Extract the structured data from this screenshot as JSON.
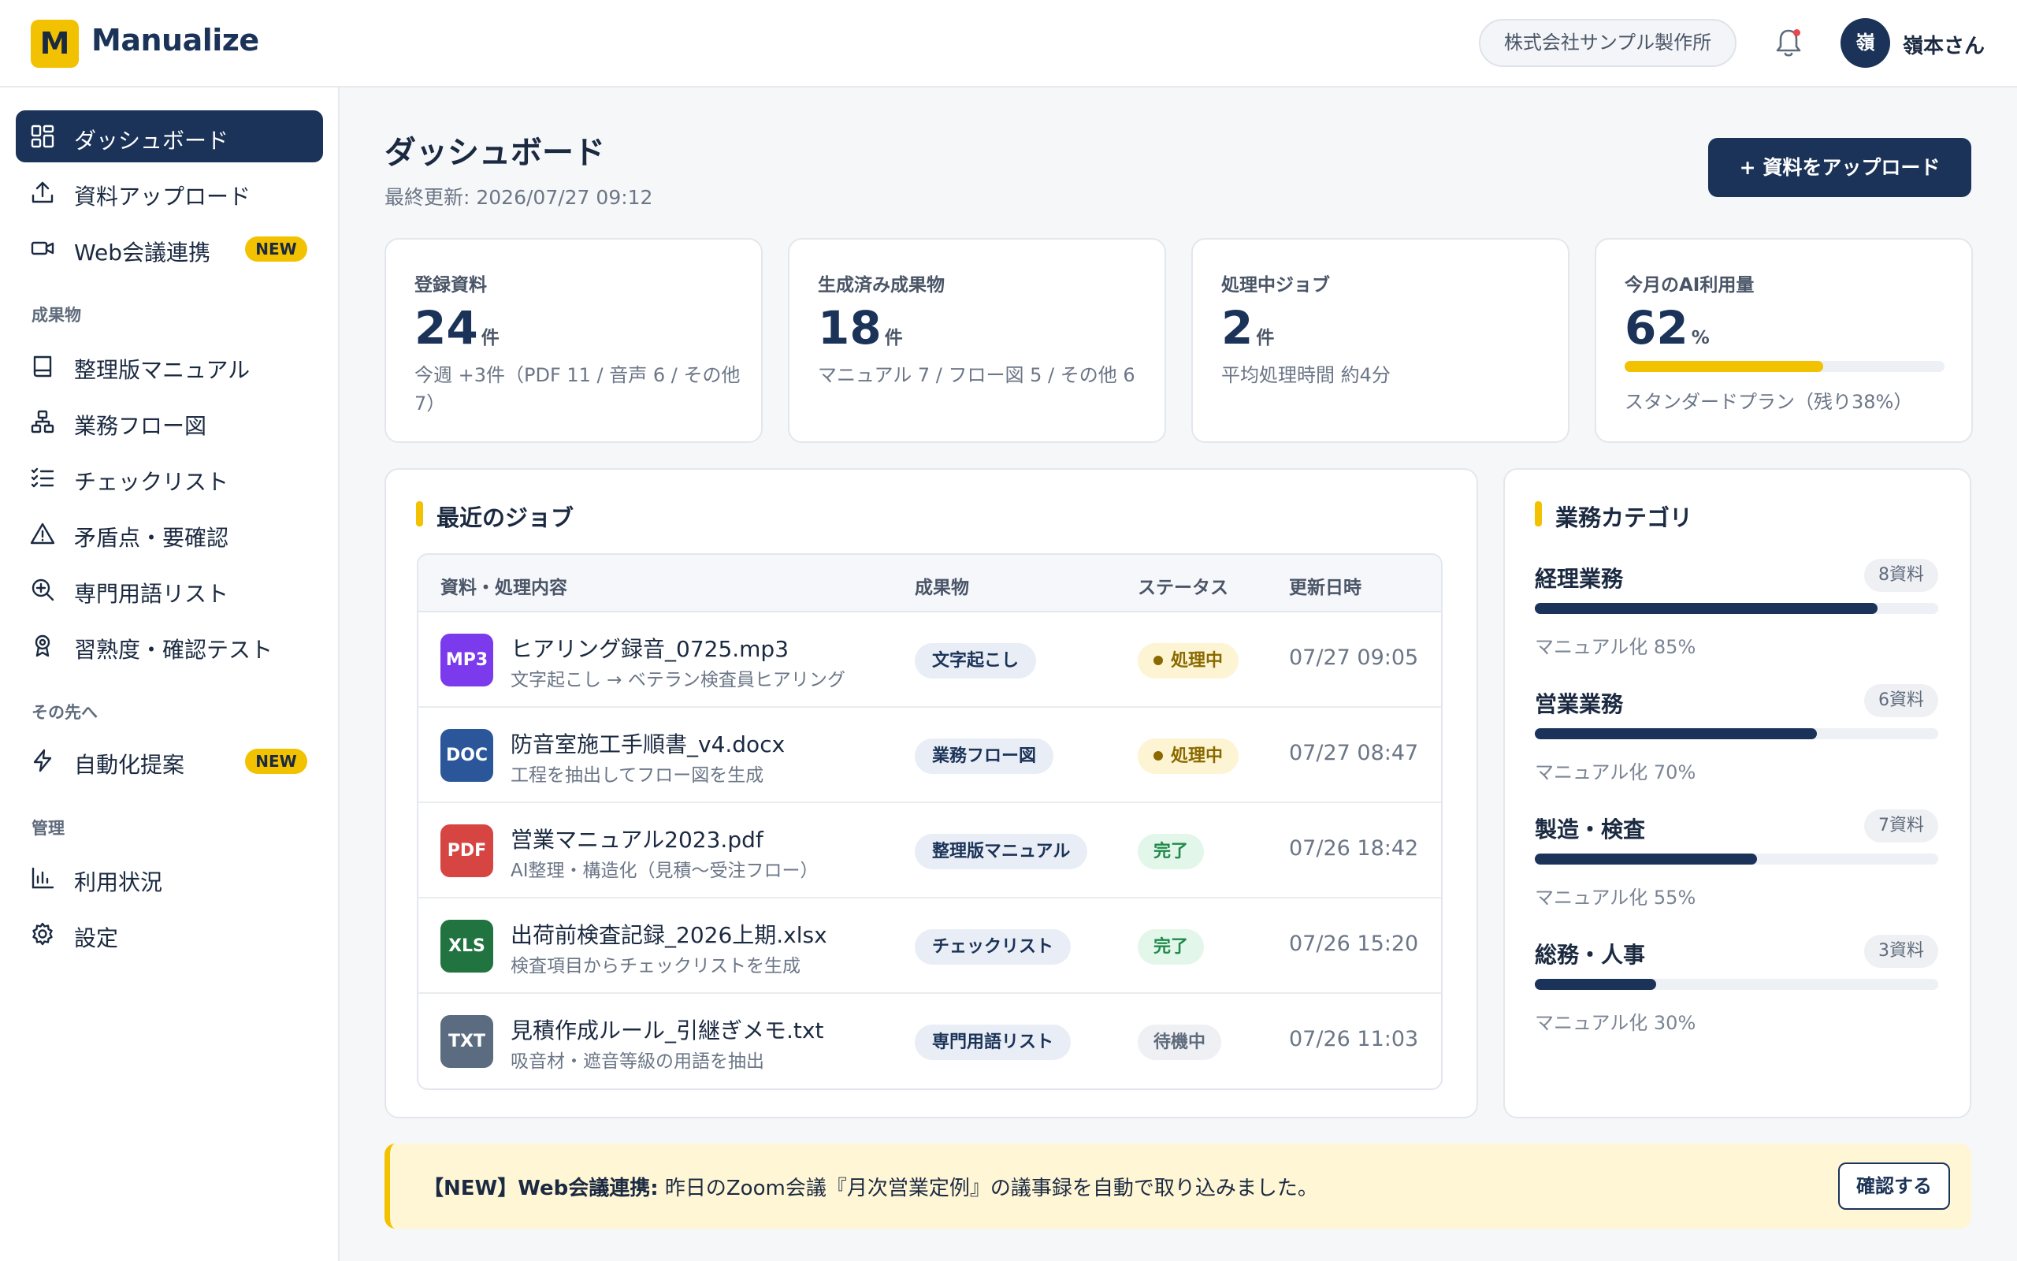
{
  "app": {
    "logo_letter": "M",
    "name": "Manualize"
  },
  "header": {
    "org": "株式会社サンプル製作所",
    "avatar_initial": "嶺",
    "user_name": "嶺本さん"
  },
  "sidebar": {
    "items": [
      {
        "label": "ダッシュボード",
        "icon": "dashboard-icon",
        "active": true
      },
      {
        "label": "資料アップロード",
        "icon": "upload-icon"
      },
      {
        "label": "Web会議連携",
        "icon": "video-icon",
        "badge": "NEW"
      }
    ],
    "sections": [
      {
        "title": "成果物",
        "items": [
          {
            "label": "整理版マニュアル",
            "icon": "book-icon"
          },
          {
            "label": "業務フロー図",
            "icon": "flow-icon"
          },
          {
            "label": "チェックリスト",
            "icon": "checklist-icon"
          },
          {
            "label": "矛盾点・要確認",
            "icon": "warning-icon"
          },
          {
            "label": "専門用語リスト",
            "icon": "search-plus-icon"
          },
          {
            "label": "習熟度・確認テスト",
            "icon": "award-icon"
          }
        ]
      },
      {
        "title": "その先へ",
        "items": [
          {
            "label": "自動化提案",
            "icon": "bolt-icon",
            "badge": "NEW"
          }
        ]
      },
      {
        "title": "管理",
        "items": [
          {
            "label": "利用状況",
            "icon": "bar-chart-icon"
          },
          {
            "label": "設定",
            "icon": "gear-icon"
          }
        ]
      }
    ]
  },
  "main": {
    "title": "ダッシュボード",
    "last_update": "最終更新: 2026/07/27 09:12",
    "upload_button": "+ 資料をアップロード",
    "stats": [
      {
        "label": "登録資料",
        "value": "24",
        "unit": "件",
        "desc": "今週 +3件（PDF 11 / 音声 6 / その他 7）"
      },
      {
        "label": "生成済み成果物",
        "value": "18",
        "unit": "件",
        "desc": "マニュアル 7 / フロー図 5 / その他 6"
      },
      {
        "label": "処理中ジョブ",
        "value": "2",
        "unit": "件",
        "desc": "平均処理時間 約4分"
      },
      {
        "label": "今月のAI利用量",
        "value": "62",
        "unit": "%",
        "desc": "スタンダードプラン（残り38%）",
        "progress": 0.62
      }
    ],
    "jobs": {
      "title": "最近のジョブ",
      "columns": [
        "資料・処理内容",
        "成果物",
        "ステータス",
        "更新日時"
      ],
      "rows": [
        {
          "type": "MP3",
          "color": "#7c3aed",
          "name": "ヒアリング録音_0725.mp3",
          "desc": "文字起こし → ベテラン検査員ヒアリング",
          "output": "文字起こし",
          "status": "処理中",
          "status_kind": "processing",
          "date": "07/27 09:05"
        },
        {
          "type": "DOC",
          "color": "#2b579a",
          "name": "防音室施工手順書_v4.docx",
          "desc": "工程を抽出してフロー図を生成",
          "output": "業務フロー図",
          "status": "処理中",
          "status_kind": "processing",
          "date": "07/27 08:47"
        },
        {
          "type": "PDF",
          "color": "#d64541",
          "name": "営業マニュアル2023.pdf",
          "desc": "AI整理・構造化（見積〜受注フロー）",
          "output": "整理版マニュアル",
          "status": "完了",
          "status_kind": "done",
          "date": "07/26 18:42"
        },
        {
          "type": "XLS",
          "color": "#21733f",
          "name": "出荷前検査記録_2026上期.xlsx",
          "desc": "検査項目からチェックリストを生成",
          "output": "チェックリスト",
          "status": "完了",
          "status_kind": "done",
          "date": "07/26 15:20"
        },
        {
          "type": "TXT",
          "color": "#5b6b80",
          "name": "見積作成ルール_引継ぎメモ.txt",
          "desc": "吸音材・遮音等級の用語を抽出",
          "output": "専門用語リスト",
          "status": "待機中",
          "status_kind": "waiting",
          "date": "07/26 11:03"
        }
      ]
    },
    "categories": {
      "title": "業務カテゴリ",
      "items": [
        {
          "name": "経理業務",
          "count": "8資料",
          "progress": 0.85,
          "sub": "マニュアル化 85%"
        },
        {
          "name": "営業業務",
          "count": "6資料",
          "progress": 0.7,
          "sub": "マニュアル化 70%"
        },
        {
          "name": "製造・検査",
          "count": "7資料",
          "progress": 0.55,
          "sub": "マニュアル化 55%"
        },
        {
          "name": "総務・人事",
          "count": "3資料",
          "progress": 0.3,
          "sub": "マニュアル化 30%"
        }
      ]
    },
    "notice": {
      "title": "【NEW】Web会議連携:",
      "text": " 昨日のZoom会議『月次営業定例』の議事録を自動で取り込みました。",
      "button": "確認する"
    }
  },
  "colors": {
    "brand": "#1b3358",
    "accent": "#f2c200"
  }
}
